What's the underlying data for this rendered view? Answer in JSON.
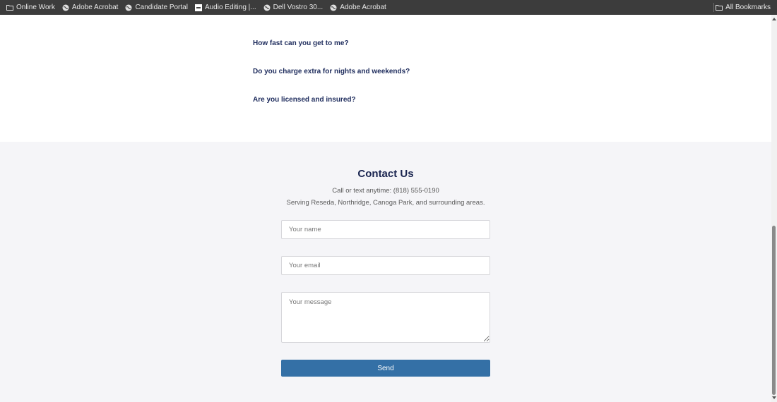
{
  "bookmarks": {
    "items": [
      {
        "label": "Online Work",
        "icon": "folder-icon"
      },
      {
        "label": "Adobe Acrobat",
        "icon": "globe-icon"
      },
      {
        "label": "Candidate Portal",
        "icon": "globe-icon"
      },
      {
        "label": "Audio Editing |...",
        "icon": "site-favicon-icon"
      },
      {
        "label": "Dell Vostro 30...",
        "icon": "globe-icon"
      },
      {
        "label": "Adobe Acrobat",
        "icon": "globe-icon"
      }
    ],
    "all_bookmarks": "All Bookmarks"
  },
  "faq": {
    "items": [
      "How fast can you get to me?",
      "Do you charge extra for nights and weekends?",
      "Are you licensed and insured?"
    ]
  },
  "contact": {
    "title": "Contact Us",
    "line1": "Call or text anytime: (818) 555-0190",
    "line2": "Serving Reseda, Northridge, Canoga Park, and surrounding areas.",
    "name_placeholder": "Your name",
    "email_placeholder": "Your email",
    "message_placeholder": "Your message",
    "send_label": "Send"
  },
  "colors": {
    "button": "#3470a6",
    "heading": "#1a2550",
    "section_bg": "#f5f5f8"
  }
}
